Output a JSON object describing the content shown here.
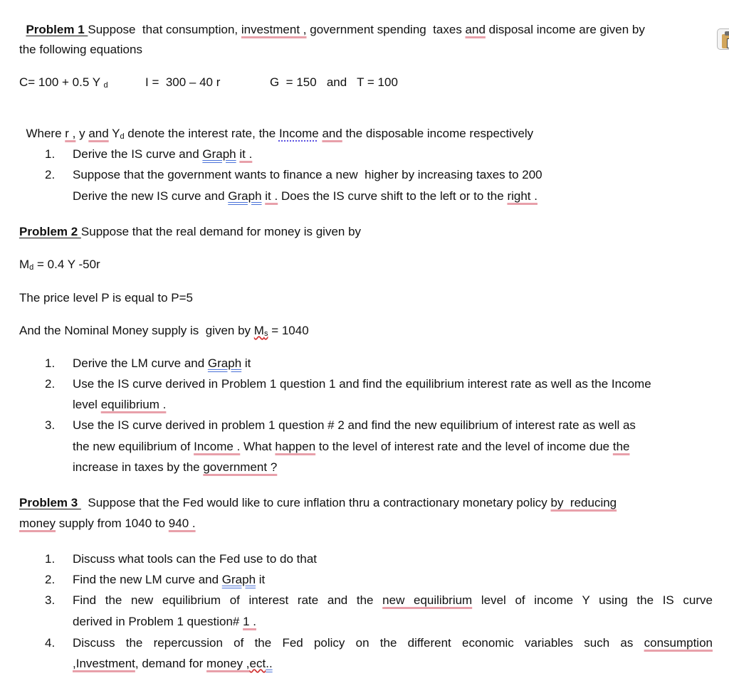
{
  "problem1": {
    "heading": "Problem 1 ",
    "intro_parts": [
      "Suppose  that consumption, ",
      "investment ,",
      " government spending  taxes ",
      "and",
      " disposal income are given by"
    ],
    "intro_line2": "the following equations",
    "equations": {
      "consumption": {
        "lhs": "C= 100 + 0.5 Y ",
        "sub": "d"
      },
      "investment": "I =  300 – 40 r",
      "government_taxes": "G  = 150   and   T = 100"
    },
    "where_parts": [
      "Where ",
      "r ,",
      " y ",
      "and",
      " Y",
      "d",
      " denote the interest rate, the ",
      "Income",
      " ",
      "and",
      " the disposable income respectively"
    ],
    "questions": [
      {
        "number": "1.",
        "parts": [
          "Derive the IS curve and ",
          "Graph",
          " ",
          "it .",
          ""
        ]
      },
      {
        "number": "2.",
        "line1": "Suppose that the government wants to finance a new  higher by increasing taxes to 200",
        "line2_parts": [
          "Derive the new IS curve and ",
          "Graph",
          " ",
          "it .",
          " Does the IS curve shift to the left or to the ",
          "right ."
        ]
      }
    ]
  },
  "problem2": {
    "heading": "Problem 2 ",
    "intro": "Suppose that the real demand for money is given by",
    "money_demand": {
      "m": "M",
      "sub": "d",
      "rest": " = 0.4 Y -50r"
    },
    "price_level": "The price level P is equal to P=5",
    "money_supply_parts": [
      "And the Nominal Money supply is  given by ",
      "M",
      "s",
      " = 1040"
    ],
    "questions": [
      {
        "number": "1.",
        "parts": [
          "Derive the LM curve and ",
          "Graph",
          " it"
        ]
      },
      {
        "number": "2.",
        "line1": "Use the IS curve derived in Problem 1 question 1 and find the equilibrium interest rate as well as the Income",
        "line2_parts": [
          "level ",
          "equilibrium ."
        ]
      },
      {
        "number": "3.",
        "line1": "Use the IS curve derived in problem 1 question # 2 and find the new equilibrium of interest rate as well as",
        "line2_parts": [
          "the new equilibrium of ",
          "Income .",
          " What ",
          "happen",
          " to the level of interest rate and the level of income due ",
          "the"
        ],
        "line3_parts": [
          "increase in taxes by the ",
          "government ?"
        ]
      }
    ]
  },
  "problem3": {
    "heading": "Problem 3 ",
    "intro_parts": [
      "  Suppose that the Fed would like to cure inflation thru a contractionary monetary policy ",
      "by  reducing"
    ],
    "intro_line2_parts": [
      "money",
      " supply from 1040 to ",
      "940 ."
    ],
    "questions": [
      {
        "number": "1.",
        "text": "Discuss what tools can the Fed use to do that"
      },
      {
        "number": "2.",
        "parts": [
          "Find the new LM curve and ",
          "Graph",
          " it"
        ]
      },
      {
        "number": "3.",
        "line1_parts": [
          "Find the new equilibrium of interest rate and the ",
          "new  equilibrium",
          " level of income Y  using the IS curve"
        ],
        "line2_parts": [
          "derived in Problem 1 question# ",
          "1 ."
        ]
      },
      {
        "number": "4.",
        "line1_parts": [
          "Discuss the repercussion of the Fed policy on the different economic variables such as ",
          "consumption"
        ],
        "line2_parts": [
          ",Investment",
          ", demand for ",
          "money ,",
          "ect",
          ".."
        ]
      }
    ]
  },
  "icons": {
    "paste_options": "clipboard-icon"
  }
}
